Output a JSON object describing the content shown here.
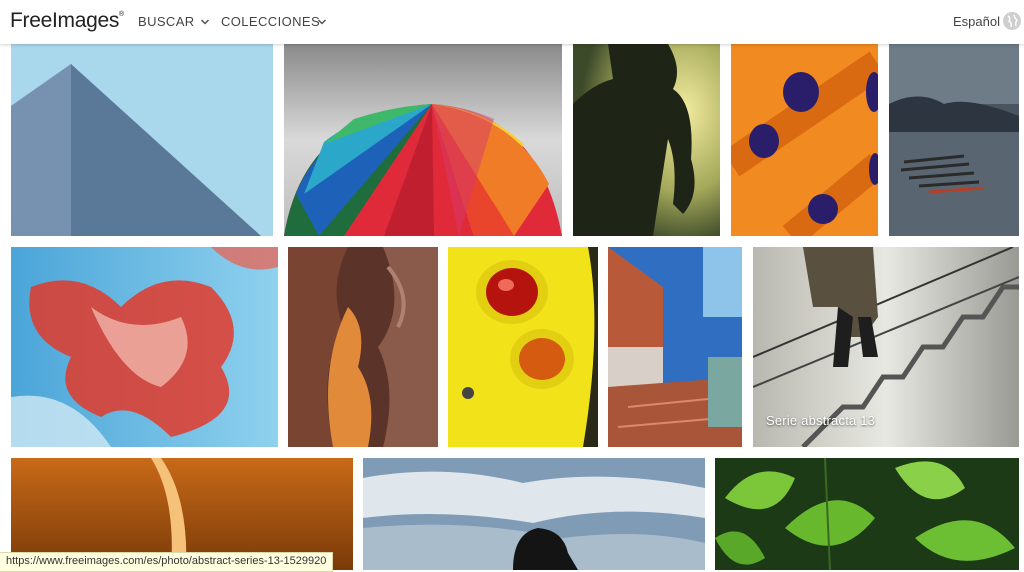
{
  "header": {
    "logo_text": "FreeImages",
    "logo_mark": "®",
    "nav": [
      {
        "label": "BUSCAR",
        "icon": "chevron-down-icon"
      },
      {
        "label": "COLECCIONES",
        "icon": "chevron-down-icon"
      }
    ],
    "language": "Español",
    "language_icon": "globe-icon"
  },
  "gallery": {
    "rows": [
      {
        "tiles": [
          {
            "subject": "pyramid"
          },
          {
            "subject": "umbrella"
          },
          {
            "subject": "silhouette"
          },
          {
            "subject": "orange-abstract"
          },
          {
            "subject": "lake-boats"
          }
        ]
      },
      {
        "tiles": [
          {
            "subject": "blur-abstract"
          },
          {
            "subject": "canyon"
          },
          {
            "subject": "yellow-car"
          },
          {
            "subject": "blue-building"
          },
          {
            "subject": "stairs",
            "caption": "Serie abstracta 13"
          }
        ]
      },
      {
        "tiles": [
          {
            "subject": "orange-light"
          },
          {
            "subject": "sky-silhouette"
          },
          {
            "subject": "leaves"
          }
        ]
      }
    ]
  },
  "status_bar": {
    "url": "https://www.freeimages.com/es/photo/abstract-series-13-1529920"
  }
}
